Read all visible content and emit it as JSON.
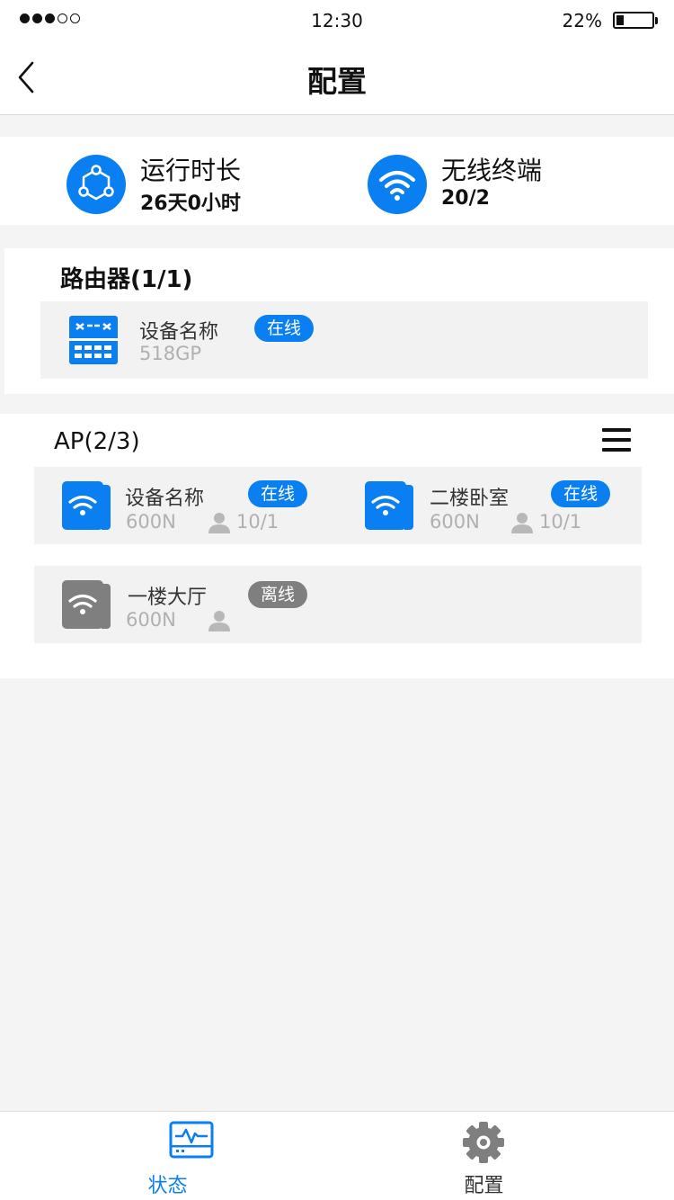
{
  "status_bar": {
    "time": "12:30",
    "battery_text": "22%",
    "battery_level": 0.22,
    "signal_bars_filled": 3,
    "signal_bars_total": 5
  },
  "nav": {
    "back_icon": "chevron-left-icon",
    "title": "配置"
  },
  "summary": {
    "uptime": {
      "icon": "network-nodes-icon",
      "label": "运行时长",
      "value": "26天0小时"
    },
    "wireless": {
      "icon": "wifi-icon",
      "label": "无线终端",
      "value": "20/2"
    }
  },
  "router_section": {
    "title": "路由器(1/1)",
    "device": {
      "icon": "router-icon",
      "name": "设备名称",
      "model": "518GP",
      "status": "在线"
    }
  },
  "ap_section": {
    "title": "AP(2/3)",
    "menu_icon": "menu-icon",
    "items": [
      {
        "name": "设备名称",
        "model": "600N",
        "users": "10/1",
        "status": "在线",
        "online": true
      },
      {
        "name": "二楼卧室",
        "model": "600N",
        "users": "10/1",
        "status": "在线",
        "online": true
      },
      {
        "name": "一楼大厅",
        "model": "600N",
        "users": "",
        "status": "离线",
        "online": false
      }
    ]
  },
  "tab_bar": {
    "tabs": [
      {
        "label": "状态",
        "icon": "monitor-pulse-icon",
        "active": true
      },
      {
        "label": "配置",
        "icon": "gear-icon",
        "active": false
      }
    ]
  },
  "colors": {
    "accent": "#0a7ff2",
    "offline": "#7f7f7f",
    "muted_text": "#b0b0b0",
    "background": "#f4f4f4"
  }
}
